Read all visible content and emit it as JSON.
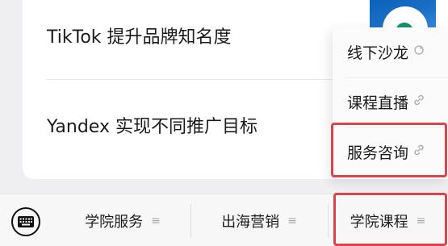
{
  "articles": [
    {
      "title": "TikTok 提升品牌知名度"
    },
    {
      "title": "Yandex 实现不同推广目标"
    }
  ],
  "popup_menu": {
    "items": [
      {
        "label": "线下沙龙",
        "icon": "mini-program-icon"
      },
      {
        "label": "课程直播",
        "icon": "link-icon"
      },
      {
        "label": "服务咨询",
        "icon": "link-icon"
      }
    ]
  },
  "bottom_menu": {
    "keyboard_icon": "keyboard-icon",
    "tabs": [
      {
        "label": "学院服务",
        "icon": "menu-icon"
      },
      {
        "label": "出海营销",
        "icon": "menu-icon"
      },
      {
        "label": "学院课程",
        "icon": "menu-icon"
      }
    ]
  },
  "colors": {
    "highlight": "#d9454a",
    "background": "#efeff1",
    "card": "#ffffff",
    "icon_gray": "#a9a9a9"
  }
}
